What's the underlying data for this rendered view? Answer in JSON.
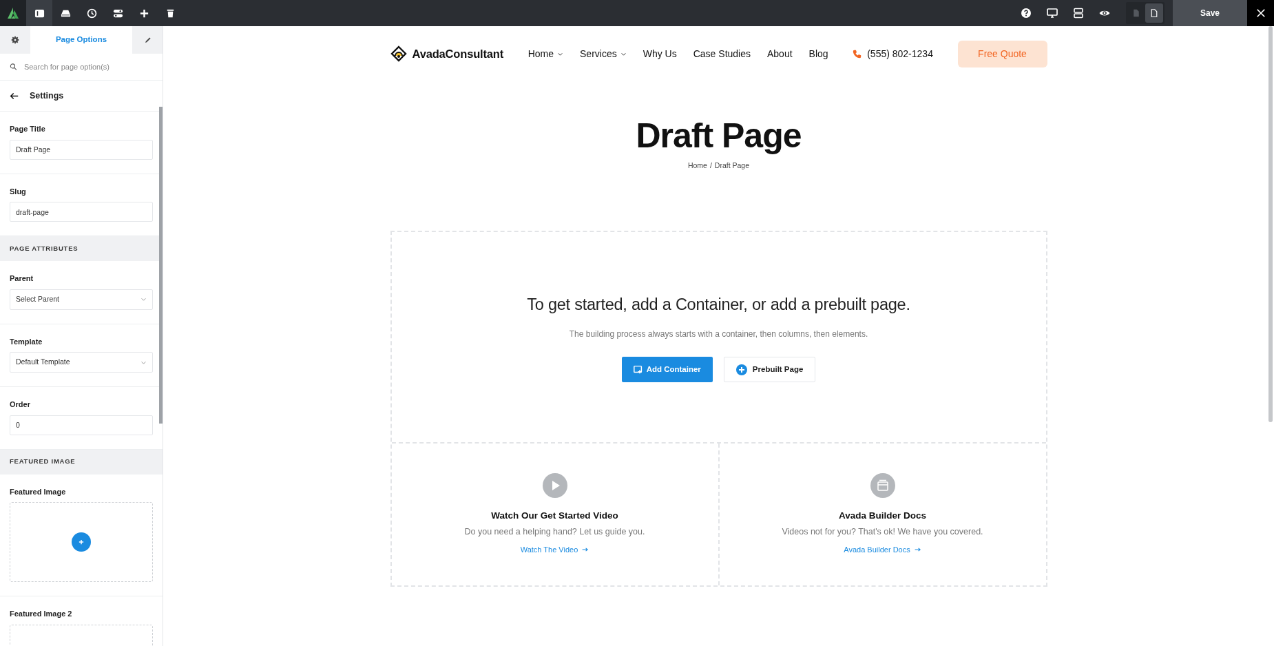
{
  "toolbar": {
    "left_tools": [
      {
        "kind": "sidebar",
        "selected": true
      },
      {
        "kind": "library",
        "selected": false
      },
      {
        "kind": "history",
        "selected": false
      },
      {
        "kind": "toggles",
        "selected": false
      },
      {
        "kind": "add",
        "selected": false
      },
      {
        "kind": "delete",
        "selected": false
      }
    ],
    "right_tools": [
      {
        "kind": "help"
      },
      {
        "kind": "desktop"
      },
      {
        "kind": "layout"
      },
      {
        "kind": "preview"
      }
    ],
    "view_toggle": [
      {
        "kind": "draft",
        "selected": false
      },
      {
        "kind": "page",
        "selected": true
      }
    ],
    "save_label": "Save"
  },
  "sidebar": {
    "tabs": [
      {
        "kind": "settings",
        "selected": false
      },
      {
        "kind": "label",
        "label": "Page Options",
        "selected": true
      },
      {
        "kind": "edit",
        "selected": false
      }
    ],
    "search": {
      "placeholder": "Search for page option(s)"
    },
    "heading": "Settings",
    "fields": [
      {
        "kind": "text",
        "label": "Page Title",
        "value": "Draft Page"
      },
      {
        "kind": "text",
        "label": "Slug",
        "value": "draft-page"
      },
      {
        "kind": "section",
        "label": "PAGE ATTRIBUTES"
      },
      {
        "kind": "select",
        "label": "Parent",
        "value": "Select Parent"
      },
      {
        "kind": "select",
        "label": "Template",
        "value": "Default Template"
      },
      {
        "kind": "text",
        "label": "Order",
        "value": "0"
      },
      {
        "kind": "section",
        "label": "FEATURED IMAGE"
      },
      {
        "kind": "image",
        "label": "Featured Image",
        "add_button": true
      },
      {
        "kind": "image",
        "label": "Featured Image 2"
      }
    ]
  },
  "site": {
    "brand": "AvadaConsultant",
    "nav": [
      {
        "label": "Home",
        "dropdown": true
      },
      {
        "label": "Services",
        "dropdown": true
      },
      {
        "label": "Why Us",
        "dropdown": false
      },
      {
        "label": "Case Studies",
        "dropdown": false
      },
      {
        "label": "About",
        "dropdown": false
      },
      {
        "label": "Blog",
        "dropdown": false
      }
    ],
    "phone": "(555) 802-1234",
    "cta": "Free Quote",
    "title": "Draft Page",
    "breadcrumb": {
      "items": [
        "Home",
        "Draft Page"
      ],
      "separator": "/"
    }
  },
  "builder": {
    "heading": "To get started, add a Container, or add a prebuilt page.",
    "subtitle": "The building process always starts with a container, then columns, then elements.",
    "buttons": [
      {
        "kind": "primary",
        "label": "Add Container"
      },
      {
        "kind": "secondary",
        "label": "Prebuilt Page"
      }
    ],
    "cards": [
      {
        "kind": "video",
        "title": "Watch Our Get Started Video",
        "text": "Do you need a helping hand? Let us guide you.",
        "link": "Watch The Video"
      },
      {
        "kind": "docs",
        "title": "Avada Builder Docs",
        "text": "Videos not for you? That's ok! We have you covered.",
        "link": "Avada Builder Docs"
      }
    ]
  }
}
